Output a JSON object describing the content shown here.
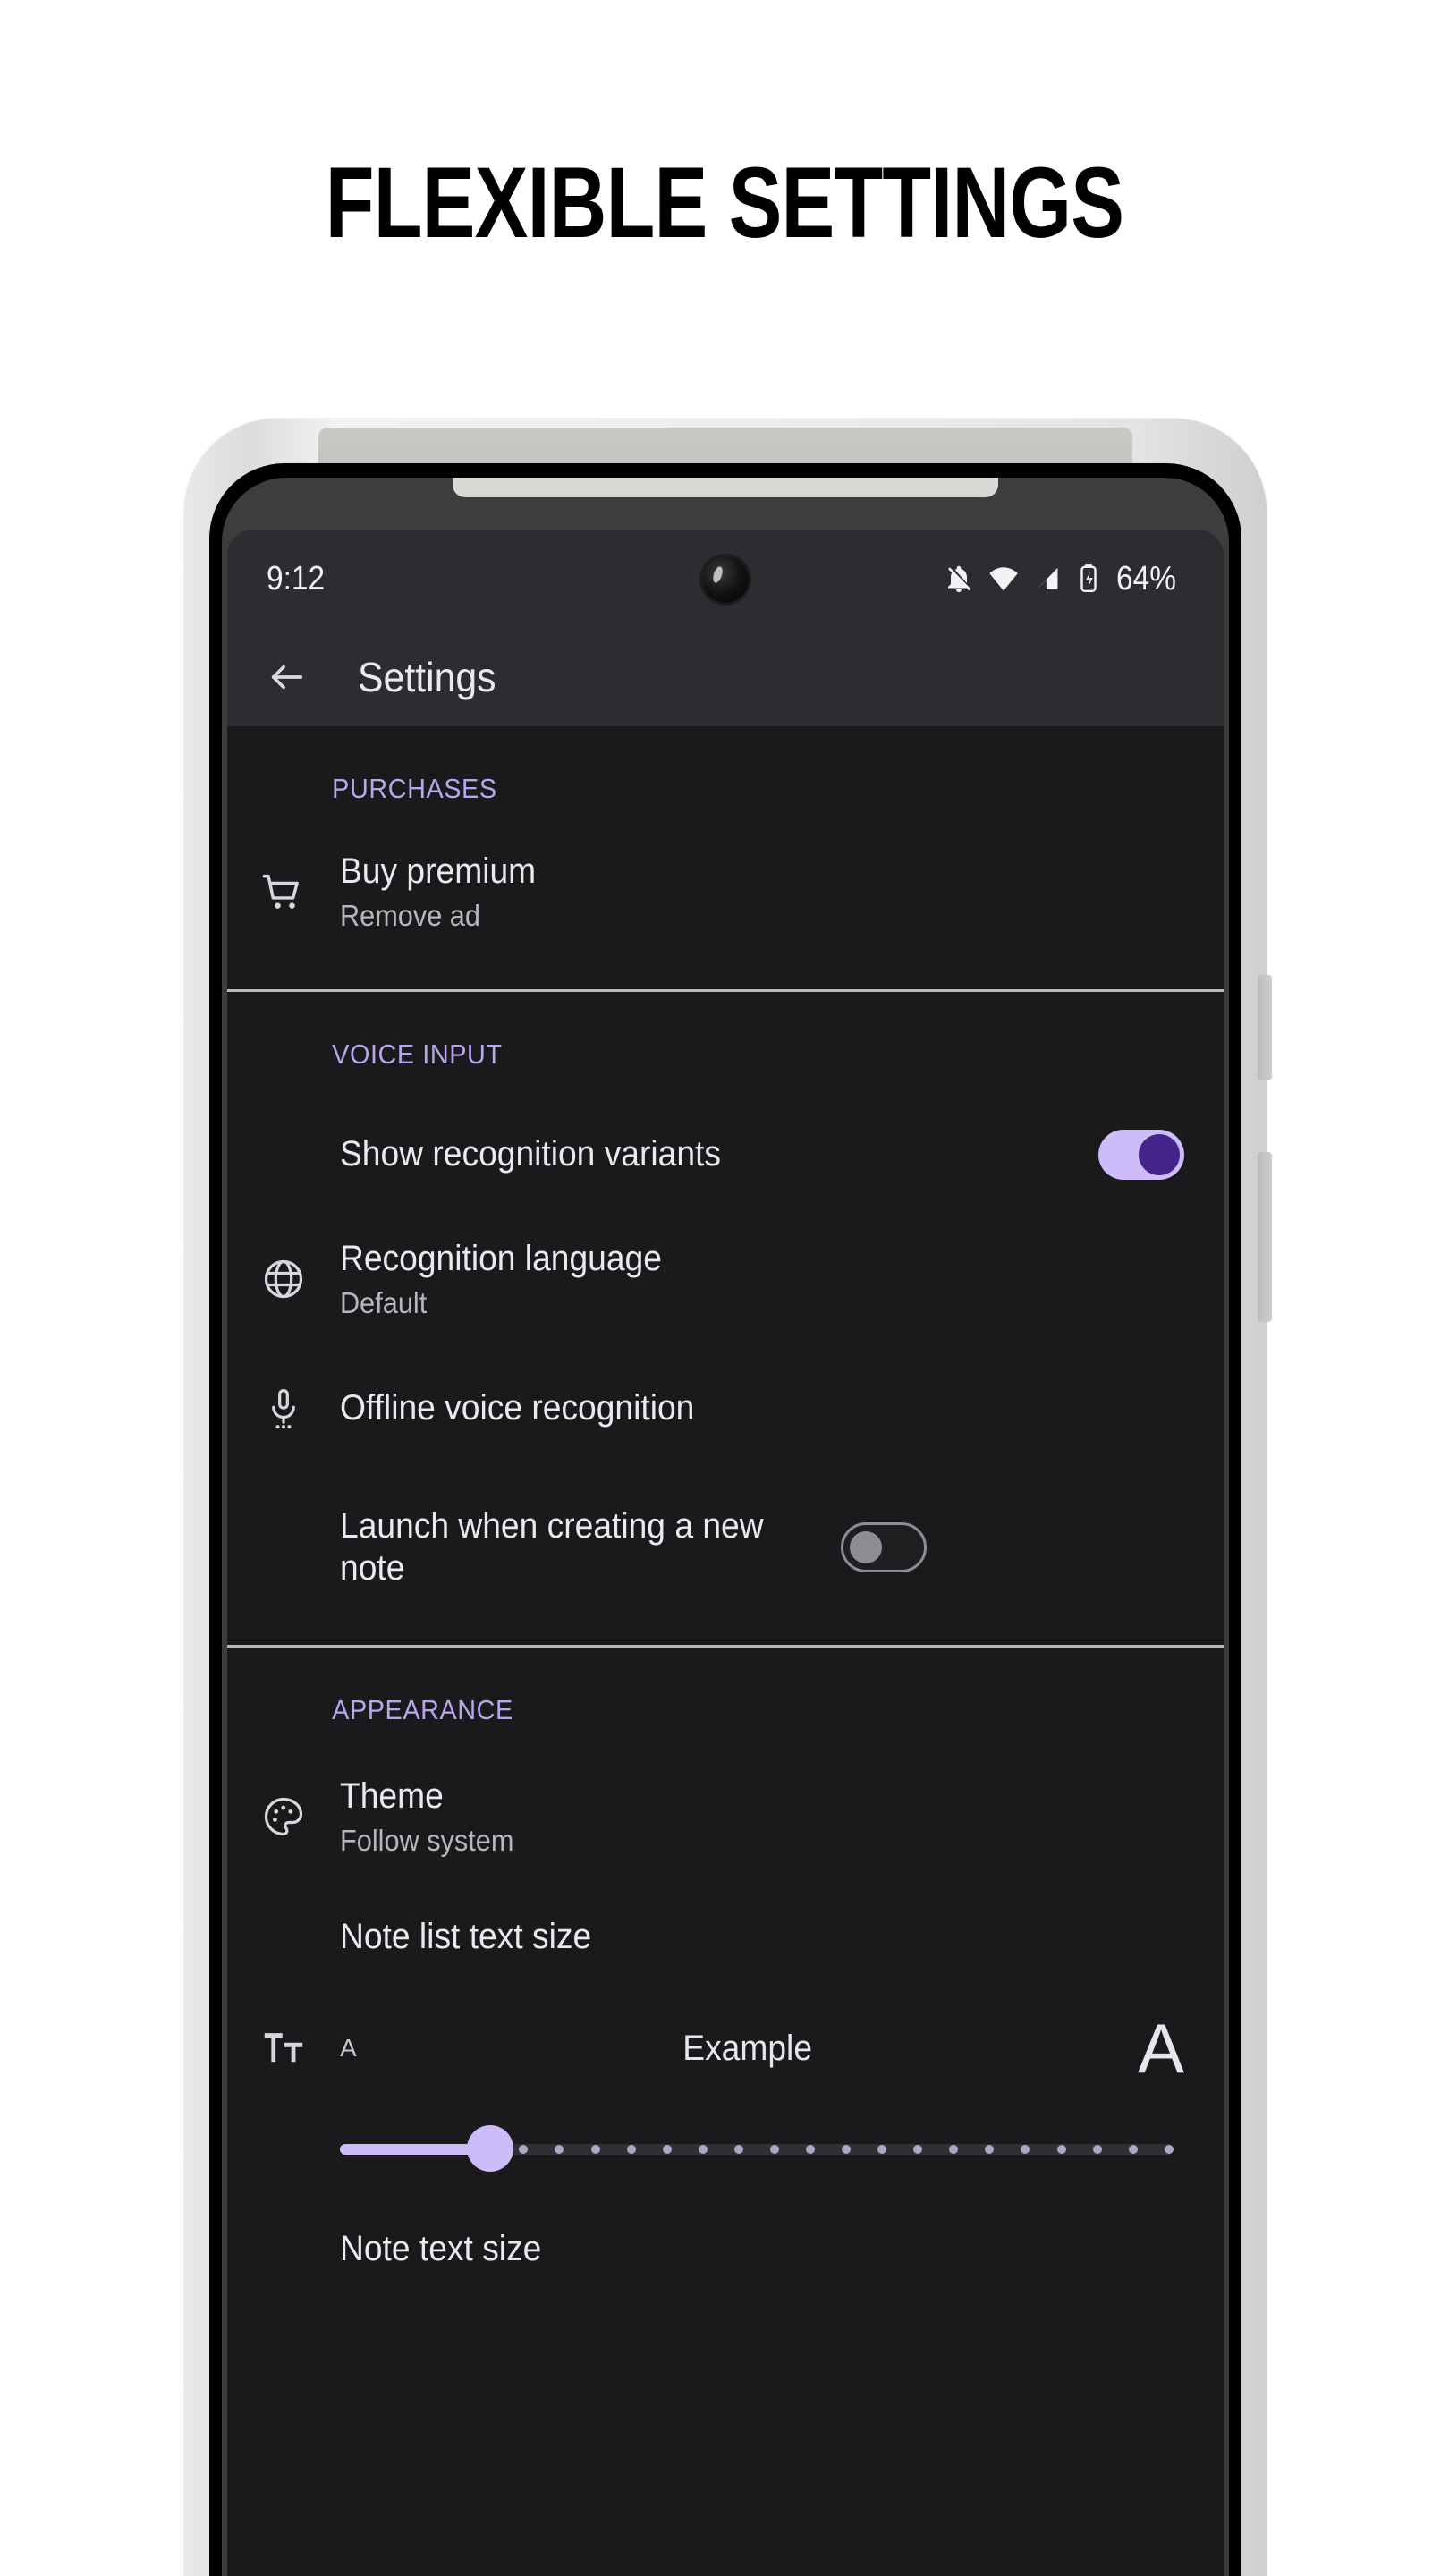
{
  "headline": "FLEXIBLE SETTINGS",
  "statusbar": {
    "time": "9:12",
    "battery": "64%",
    "icons": [
      "notifications-off-icon",
      "wifi-icon",
      "cell-signal-icon",
      "battery-charging-icon"
    ]
  },
  "appbar": {
    "back_label": "back-arrow-icon",
    "title": "Settings"
  },
  "sections": [
    {
      "header": "PURCHASES",
      "rows": [
        {
          "icon": "shopping-cart-icon",
          "title": "Buy premium",
          "subtitle": "Remove ad"
        }
      ]
    },
    {
      "header": "VOICE INPUT",
      "rows": [
        {
          "icon": "",
          "title": "Show recognition variants",
          "subtitle": "",
          "toggle": "on"
        },
        {
          "icon": "globe-icon",
          "title": "Recognition language",
          "subtitle": "Default"
        },
        {
          "icon": "microphone-offline-icon",
          "title": "Offline voice recognition",
          "subtitle": ""
        },
        {
          "icon": "",
          "title": "Launch when creating a new note",
          "subtitle": "",
          "toggle": "off"
        }
      ]
    },
    {
      "header": "APPEARANCE",
      "rows": [
        {
          "icon": "palette-icon",
          "title": "Theme",
          "subtitle": "Follow system"
        },
        {
          "icon": "",
          "title": "Note list text size",
          "subtitle": ""
        }
      ],
      "text_size_preview": {
        "icon": "format-size-icon",
        "small_label": "A",
        "sample_text": "Example",
        "large_label": "A"
      },
      "slider": {
        "value": 4,
        "min": 0,
        "max": 23,
        "ticks": 24,
        "fill_percent": 18
      },
      "trailing_rows": [
        {
          "icon": "",
          "title": "Note text size",
          "subtitle": ""
        }
      ]
    }
  ],
  "colors": {
    "accent_purple": "#b9a6ef",
    "toggle_track_on": "#cdbcfa",
    "toggle_knob_on": "#44238b",
    "screen_bg": "#1a1a1c",
    "appbar_bg": "#2b2d31",
    "divider": "#b9b9bc"
  }
}
